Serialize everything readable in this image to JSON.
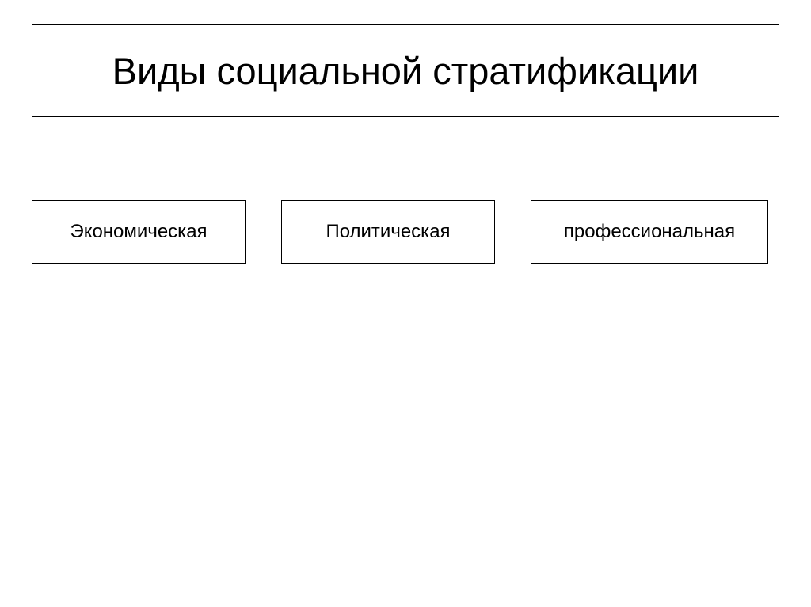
{
  "title": "Виды социальной стратификации",
  "categories": [
    "Экономическая",
    "Политическая",
    "профессиональная"
  ]
}
